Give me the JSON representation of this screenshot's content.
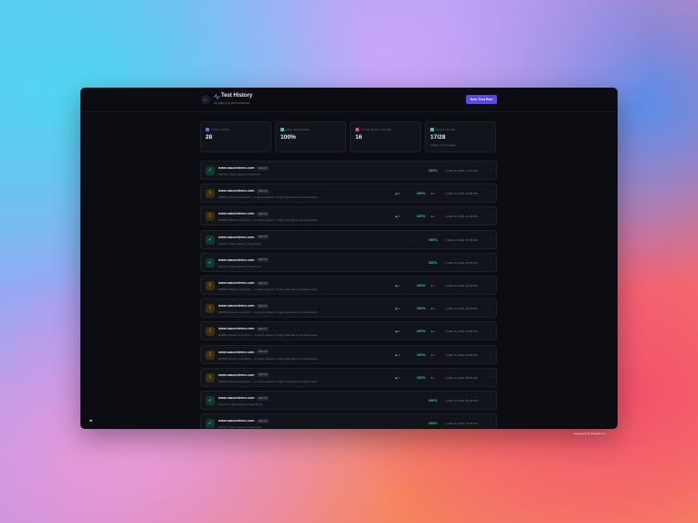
{
  "header": {
    "back_icon": "arrow-left-icon",
    "title_icon": "activity-pulse-icon",
    "title": "Test History",
    "subtitle": "All past QA test sessions",
    "new_run_label": "New Test Run"
  },
  "stats": [
    {
      "icon": "chart-icon",
      "color": "#4f7cf5",
      "label": "TOTAL RUNS",
      "value": "28",
      "sub": ""
    },
    {
      "icon": "trend-up-icon",
      "color": "#2fd39b",
      "label": "AVG PASS RATE",
      "value": "100%",
      "sub": ""
    },
    {
      "icon": "bug-icon",
      "color": "#ef4b63",
      "label": "TOTAL BUGS FOUND",
      "value": "16",
      "sub": ""
    },
    {
      "icon": "check-circle-icon",
      "color": "#2fd39b",
      "label": "CLEAN RUNS",
      "value": "17/28",
      "sub": "3 failed · 8 incomplete"
    }
  ],
  "runs": [
    {
      "status": "ok",
      "domain": "www.saucedemo.com",
      "tag": "E2E-01",
      "desc": "[OK] All 7 steps passed, 0 bugs found",
      "skipped": "",
      "pass": "100%",
      "bugs": "",
      "time": "Mar 14, 2024, 11:21 PM"
    },
    {
      "status": "warn",
      "domain": "www.saucedemo.com",
      "tag": "E2E-01",
      "desc": "[WARN] Session incomplete — 1 step(s) skipped. 1 bug(s) detected in completed steps",
      "skipped": "1",
      "pass": "100%",
      "bugs": "1",
      "time": "Mar 14, 2024, 10:55 PM"
    },
    {
      "status": "warn",
      "domain": "www.saucedemo.com",
      "tag": "E2E-01",
      "desc": "[WARN] Session incomplete — 1 step(s) skipped. 1 bug(s) detected in completed steps",
      "skipped": "1",
      "pass": "100%",
      "bugs": "1",
      "time": "Mar 14, 2024, 10:40 PM"
    },
    {
      "status": "ok",
      "domain": "www.saucedemo.com",
      "tag": "E2E-01",
      "desc": "[OK] All 7 steps passed, 0 bugs found",
      "skipped": "",
      "pass": "100%",
      "bugs": "",
      "time": "Mar 14, 2024, 10:33 PM"
    },
    {
      "status": "ok",
      "domain": "www.saucedemo.com",
      "tag": "E2E-01",
      "desc": "[OK] All 7 steps passed, 0 bugs found",
      "skipped": "",
      "pass": "100%",
      "bugs": "",
      "time": "Mar 14, 2024, 10:25 PM"
    },
    {
      "status": "warn",
      "domain": "www.saucedemo.com",
      "tag": "E2E-01",
      "desc": "[WARN] Session incomplete — 1 step(s) skipped. 1 bug(s) detected in completed steps",
      "skipped": "1",
      "pass": "100%",
      "bugs": "1",
      "time": "Mar 14, 2024, 10:18 PM"
    },
    {
      "status": "warn",
      "domain": "www.saucedemo.com",
      "tag": "E2E-01",
      "desc": "[WARN] Session incomplete — 1 step(s) skipped. 1 bug(s) detected in completed steps",
      "skipped": "1",
      "pass": "100%",
      "bugs": "1",
      "time": "Mar 14, 2024, 10:10 PM"
    },
    {
      "status": "warn",
      "domain": "www.saucedemo.com",
      "tag": "E2E-01",
      "desc": "[WARN] Session incomplete — 2 step(s) skipped. 1 bug(s) detected in completed steps",
      "skipped": "2",
      "pass": "100%",
      "bugs": "2",
      "time": "Mar 14, 2024, 10:05 PM"
    },
    {
      "status": "warn",
      "domain": "www.saucedemo.com",
      "tag": "E2E-01",
      "desc": "[WARN] Session incomplete — 1 step(s) skipped. 1 bug(s) detected in completed steps",
      "skipped": "1",
      "pass": "100%",
      "bugs": "2",
      "time": "Mar 14, 2024, 09:58 PM"
    },
    {
      "status": "warn",
      "domain": "www.saucedemo.com",
      "tag": "E2E-01",
      "desc": "[WARN] Session incomplete — 1 step(s) skipped. 1 bug(s) detected in completed steps",
      "skipped": "1",
      "pass": "100%",
      "bugs": "1",
      "time": "Mar 14, 2024, 09:51 PM"
    },
    {
      "status": "ok",
      "domain": "www.saucedemo.com",
      "tag": "E2E-01",
      "desc": "[OK] All 10 steps passed, 0 bugs found",
      "skipped": "",
      "pass": "100%",
      "bugs": "",
      "time": "Mar 14, 2024, 09:29 PM"
    },
    {
      "status": "ok",
      "domain": "www.saucedemo.com",
      "tag": "E2E-01",
      "desc": "[OK] All 7 steps passed, 0 bugs found",
      "skipped": "",
      "pass": "100%",
      "bugs": "",
      "time": "Mar 14, 2024, 07:44 PM"
    }
  ],
  "corner_badge": "N",
  "footer_credit": "Screenshot by Shotsplit.com"
}
